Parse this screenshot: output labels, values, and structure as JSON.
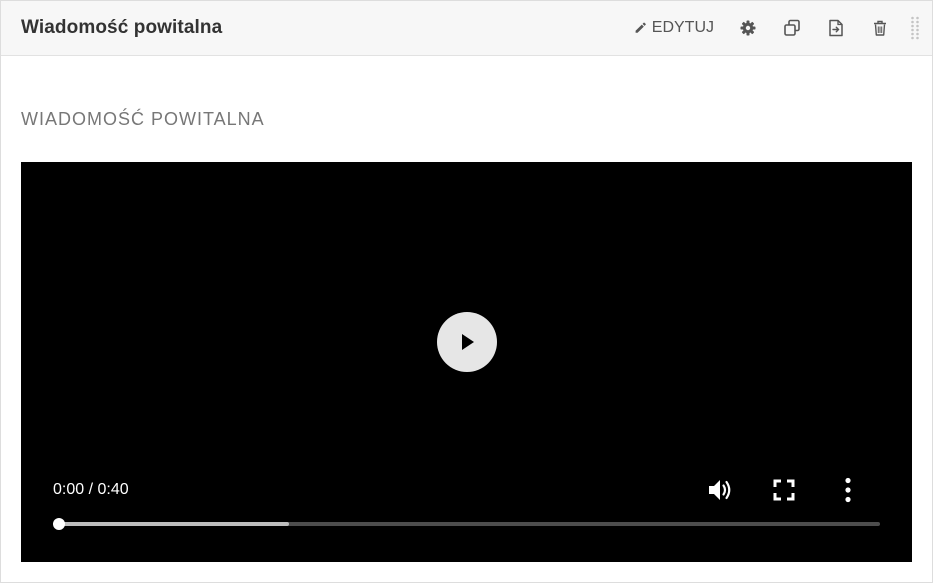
{
  "panel": {
    "title": "Wiadomość powitalna",
    "toolbar": {
      "edit_label": "EDYTUJ",
      "icons": [
        "pencil-icon",
        "gear-icon",
        "copy-icon",
        "export-icon",
        "trash-icon",
        "drag-handle-icon"
      ]
    }
  },
  "content": {
    "heading": "WIADOMOŚĆ POWITALNA"
  },
  "video": {
    "time_display": "0:00 / 0:40",
    "played_fraction": 0.0,
    "buffered_fraction": 0.28,
    "controls": [
      "play-icon",
      "volume-icon",
      "fullscreen-icon",
      "more-options-icon"
    ]
  },
  "colors": {
    "header_bg": "#f7f7f7",
    "video_bg": "#000000",
    "play_button_bg": "#e6e6e6",
    "heading_text": "#777777"
  }
}
